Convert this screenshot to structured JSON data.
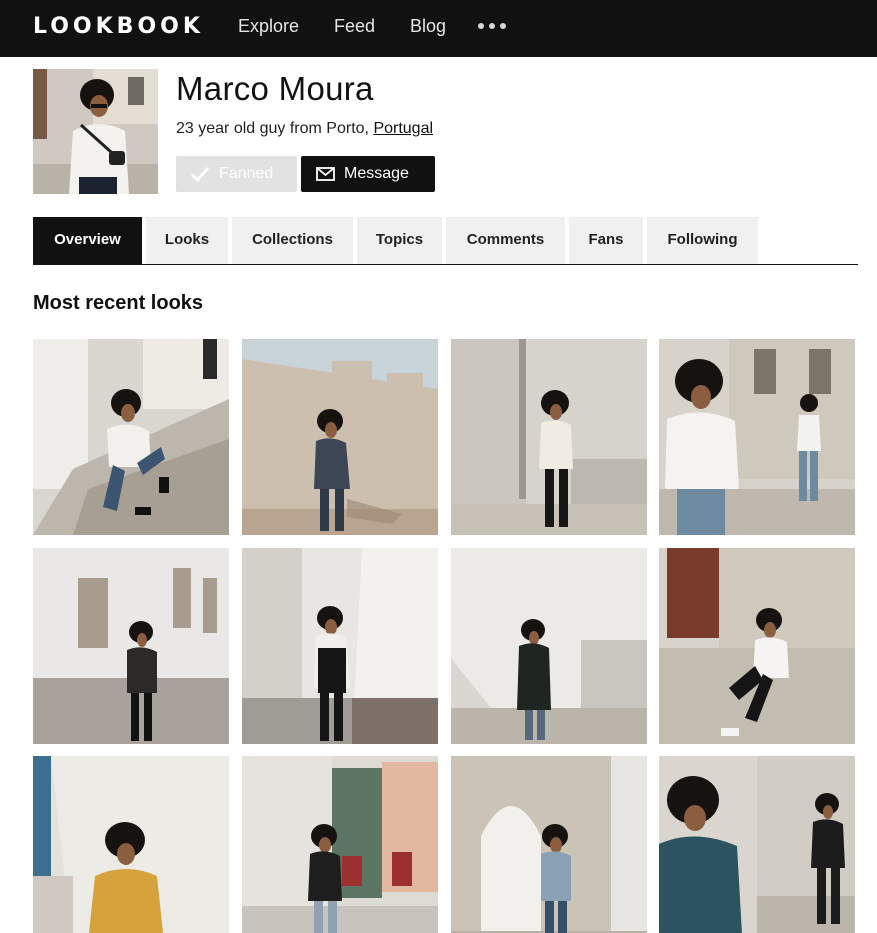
{
  "nav": {
    "logo": "LOOKBOOK",
    "links": [
      "Explore",
      "Feed",
      "Blog"
    ]
  },
  "profile": {
    "name": "Marco Moura",
    "bio_prefix": "23 year old guy from Porto, ",
    "bio_link": "Portugal",
    "fanned_label": "Fanned",
    "message_label": "Message"
  },
  "tabs": [
    "Overview",
    "Looks",
    "Collections",
    "Topics",
    "Comments",
    "Fans",
    "Following"
  ],
  "active_tab": "Overview",
  "section_title": "Most recent looks",
  "looks_count": 12,
  "colors": {
    "nav_bg": "#111111",
    "active_tab_bg": "#111111",
    "inactive_tab_bg": "#f0f0f0",
    "fanned_bg": "#e2e2e2",
    "message_bg": "#111111"
  }
}
